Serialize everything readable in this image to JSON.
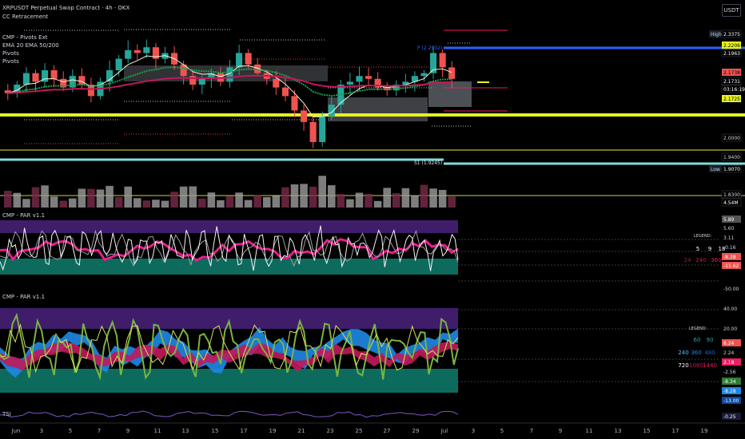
{
  "header": {
    "title": "XRPUSDT Perpetual Swap Contract · 4h · OKX",
    "indicators": [
      "CC Retracement",
      "CMP - Pivots Ext",
      "EMA 20 EMA 50/200",
      "Pivots",
      "Pivots"
    ],
    "currency_button": "USDT"
  },
  "colors": {
    "background": "#000000",
    "bull": "#26a69a",
    "bear": "#ef5350",
    "yellow": "#e6f21a",
    "cyan": "#7fdcdc",
    "blue": "#2962ff",
    "purple": "#3f1d6b",
    "teal": "#0d6b5e",
    "pink": "#e91e8c"
  },
  "chart_data": [
    {
      "type": "candlestick",
      "title": "XRPUSDT Perpetual Swap Contract · 4h · OKX",
      "x_ticks": [
        "Jun",
        "3",
        "5",
        "7",
        "9",
        "11",
        "13",
        "15",
        "17",
        "19",
        "21",
        "23",
        "25",
        "27",
        "29",
        "Jul",
        "3",
        "5",
        "7",
        "9",
        "11",
        "13",
        "15",
        "17",
        "19"
      ],
      "ylim": [
        1.85,
        2.35
      ],
      "price_scale_labels": [
        {
          "value": "2.3375",
          "tag": "High"
        },
        {
          "value": "2.2206"
        },
        {
          "value": "2.1963"
        },
        {
          "value": "2.1738"
        },
        {
          "value": "2.1731"
        },
        {
          "value": "03:16:19"
        },
        {
          "value": "2.1725"
        },
        {
          "value": "2.0000"
        },
        {
          "value": "1.9400"
        },
        {
          "value": "1.9070",
          "tag": "Low"
        },
        {
          "value": "1.8300"
        },
        {
          "value": "4.54M"
        }
      ],
      "annotations": [
        "P (2.2902)",
        "S1 (1.9245)"
      ],
      "close_series": [
        2.12,
        2.15,
        2.19,
        2.16,
        2.2,
        2.17,
        2.14,
        2.18,
        2.15,
        2.11,
        2.16,
        2.2,
        2.24,
        2.27,
        2.26,
        2.28,
        2.24,
        2.26,
        2.22,
        2.18,
        2.15,
        2.17,
        2.19,
        2.16,
        2.21,
        2.26,
        2.22,
        2.19,
        2.17,
        2.14,
        2.11,
        2.06,
        2.02,
        1.95,
        2.04,
        2.08,
        2.15,
        2.16,
        2.18,
        2.17,
        2.14,
        2.13,
        2.15,
        2.16,
        2.18,
        2.19,
        2.26,
        2.21,
        2.17
      ]
    },
    {
      "type": "line",
      "title": "CMP - PAR v1.1",
      "legend_title": "LEGEND:",
      "legend_rows": [
        [
          "5",
          "9",
          "18"
        ],
        [
          "24",
          "240",
          "360"
        ]
      ],
      "scale_labels": [
        "5.89",
        "5.60",
        "3.11",
        "-0.16",
        "-8.38",
        "-11.62",
        "-50.00"
      ]
    },
    {
      "type": "area",
      "title": "CMP - PAR v1.1",
      "legend_title": "LEGEND:",
      "legend_rows": [
        [
          "60",
          "90"
        ],
        [
          "240",
          "360",
          "480"
        ],
        [
          "720",
          "1080",
          "1440"
        ]
      ],
      "scale_labels": [
        "40.00",
        "20.00",
        "6.24",
        "2.24",
        "2.18",
        "-2.56",
        "-8.34",
        "-8.28",
        "-13.00"
      ]
    },
    {
      "type": "line",
      "title": "TSI",
      "scale_labels": [
        "-0.25"
      ]
    }
  ]
}
